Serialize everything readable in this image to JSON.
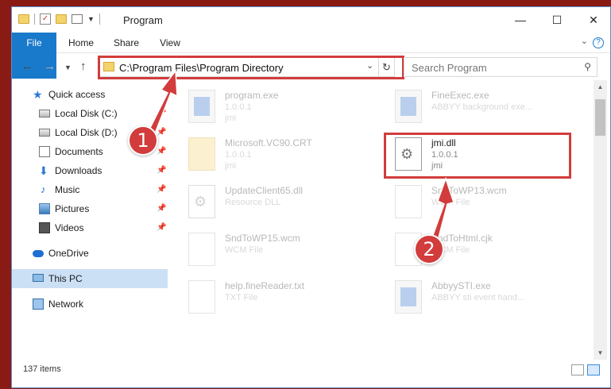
{
  "window": {
    "title": "Program"
  },
  "ribbon": {
    "tabs": [
      {
        "label": "File"
      },
      {
        "label": "Home"
      },
      {
        "label": "Share"
      },
      {
        "label": "View"
      }
    ]
  },
  "address_bar": {
    "path": "C:\\Program Files\\Program Directory"
  },
  "search": {
    "placeholder": "Search Program"
  },
  "sidebar": {
    "items": [
      {
        "label": "Quick access",
        "icon": "star-icon"
      },
      {
        "label": "Local Disk (C:)",
        "icon": "drive-icon",
        "pinned": true
      },
      {
        "label": "Local Disk (D:)",
        "icon": "drive-icon",
        "pinned": true
      },
      {
        "label": "Documents",
        "icon": "documents-icon",
        "pinned": true
      },
      {
        "label": "Downloads",
        "icon": "downloads-icon",
        "pinned": true
      },
      {
        "label": "Music",
        "icon": "music-icon",
        "pinned": true
      },
      {
        "label": "Pictures",
        "icon": "pictures-icon",
        "pinned": true
      },
      {
        "label": "Videos",
        "icon": "videos-icon",
        "pinned": true
      },
      {
        "label": "OneDrive",
        "icon": "cloud-icon"
      },
      {
        "label": "This PC",
        "icon": "computer-icon",
        "selected": true
      },
      {
        "label": "Network",
        "icon": "network-icon"
      }
    ]
  },
  "files": [
    {
      "name": "program.exe",
      "line2": "1.0.0.1",
      "line3": "jmi",
      "icon": "application-icon",
      "faded": true
    },
    {
      "name": "FineExec.exe",
      "line2": "ABBYY background exe...",
      "line3": "",
      "icon": "application-icon",
      "faded": true
    },
    {
      "name": "Microsoft.VC90.CRT",
      "line2": "1.0.0.1",
      "line3": "jmi",
      "icon": "folder-icon",
      "faded": true
    },
    {
      "name": "jmi.dll",
      "line2": "1.0.0.1",
      "line3": "jmi",
      "icon": "dll-gear-icon",
      "faded": false
    },
    {
      "name": "UpdateClient65.dll",
      "line2": "Resource DLL",
      "line3": "",
      "icon": "dll-gear-icon",
      "faded": true
    },
    {
      "name": "SndToWP13.wcm",
      "line2": "WCM File",
      "line3": "",
      "icon": "file-icon",
      "faded": true
    },
    {
      "name": "SndToWP15.wcm",
      "line2": "WCM File",
      "line3": "",
      "icon": "file-icon",
      "faded": true
    },
    {
      "name": "SndToHtml.cjk",
      "line2": "WCM File",
      "line3": "",
      "icon": "file-icon",
      "faded": true
    },
    {
      "name": "help.fineReader.txt",
      "line2": "TXT File",
      "line3": "",
      "icon": "text-file-icon",
      "faded": true
    },
    {
      "name": "AbbyySTI.exe",
      "line2": "ABBYY sti event hand...",
      "line3": "",
      "icon": "application-icon",
      "faded": true
    }
  ],
  "status": {
    "items_count": "137 items"
  },
  "callouts": [
    "1",
    "2"
  ],
  "colors": {
    "accent": "#1979ca",
    "highlight": "#d23c3c",
    "selected_bg": "#cce0f5"
  }
}
